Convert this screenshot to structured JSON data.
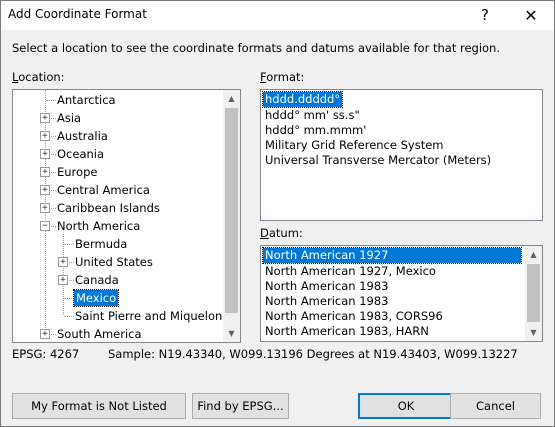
{
  "window": {
    "title": "Add Coordinate Format",
    "help_glyph": "?",
    "close_glyph": "✕"
  },
  "instruction": "Select a location to see the coordinate formats and datums available for that region.",
  "location": {
    "label_prefix": "L",
    "label_rest": "ocation:",
    "items": [
      {
        "label": "Antarctica"
      },
      {
        "label": "Asia"
      },
      {
        "label": "Australia"
      },
      {
        "label": "Oceania"
      },
      {
        "label": "Europe"
      },
      {
        "label": "Central America"
      },
      {
        "label": "Caribbean Islands"
      },
      {
        "label": "North America"
      },
      {
        "label": "Bermuda"
      },
      {
        "label": "United States"
      },
      {
        "label": "Canada"
      },
      {
        "label": "Mexico"
      },
      {
        "label": "Saint Pierre and Miquelon"
      },
      {
        "label": "South America"
      }
    ],
    "selected": "Mexico",
    "expand_glyph": "+",
    "collapse_glyph": "−"
  },
  "format": {
    "label_prefix": "F",
    "label_rest": "ormat:",
    "items": [
      {
        "label": "hddd.ddddd°"
      },
      {
        "label": "hddd° mm' ss.s\""
      },
      {
        "label": "hddd° mm.mmm'"
      },
      {
        "label": "Military Grid Reference System"
      },
      {
        "label": "Universal Transverse Mercator (Meters)"
      }
    ],
    "selected": "hddd.ddddd°"
  },
  "datum": {
    "label_prefix": "D",
    "label_rest": "atum:",
    "items": [
      {
        "label": "North American 1927"
      },
      {
        "label": "North American 1927, Mexico"
      },
      {
        "label": "North American 1983"
      },
      {
        "label": "North American 1983"
      },
      {
        "label": "North American 1983, CORS96"
      },
      {
        "label": "North American 1983, HARN"
      }
    ],
    "selected": "North American 1927"
  },
  "scroll": {
    "up": "▲",
    "down": "▼"
  },
  "epsg": "EPSG: 4267",
  "sample": "Sample: N19.43340, W099.13196 Degrees at N19.43403, W099.13227",
  "buttons": {
    "not_listed": "My Format is Not Listed",
    "find_epsg": "Find by EPSG...",
    "ok": "OK",
    "cancel": "Cancel"
  },
  "colors": {
    "selection": "#0078d7",
    "accent_border": "#0078d7"
  }
}
